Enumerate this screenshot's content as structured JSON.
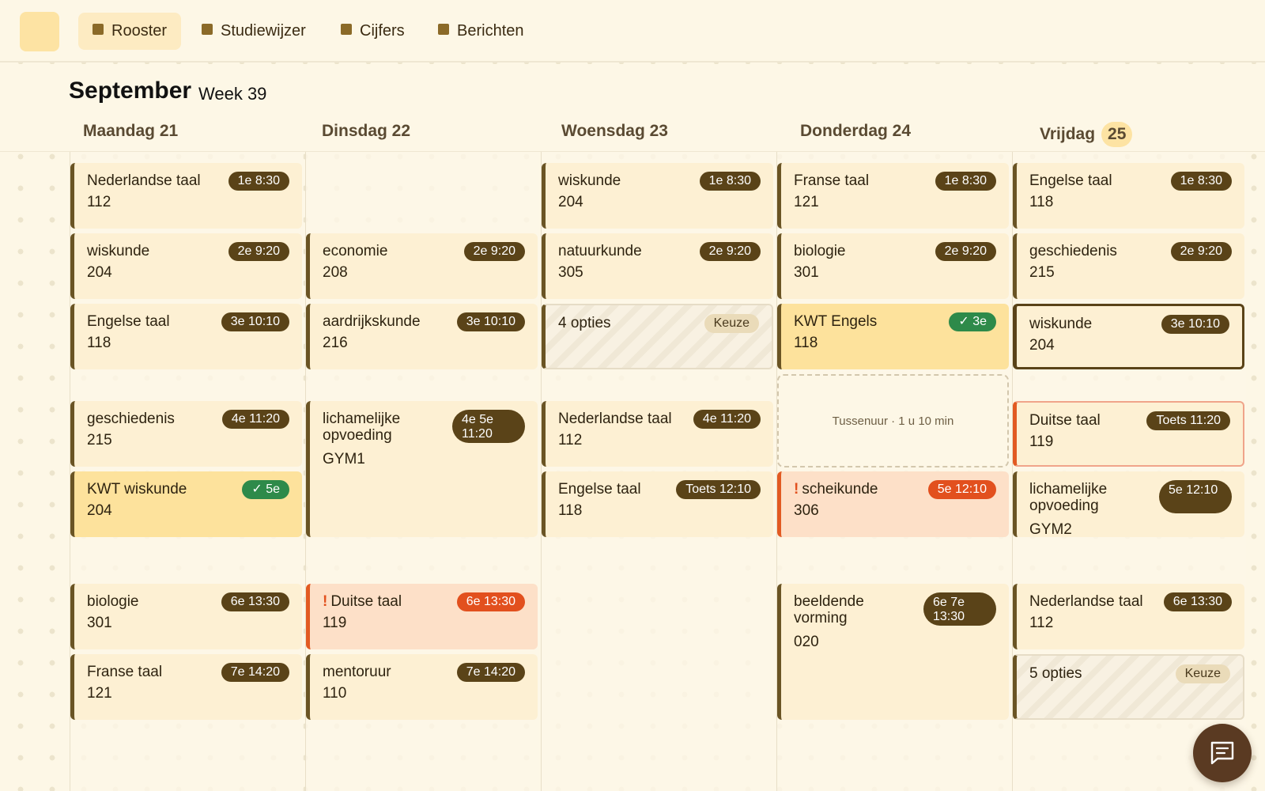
{
  "nav": {
    "tabs": [
      {
        "label": "Rooster",
        "active": true
      },
      {
        "label": "Studiewijzer",
        "active": false
      },
      {
        "label": "Cijfers",
        "active": false
      },
      {
        "label": "Berichten",
        "active": false
      }
    ]
  },
  "header": {
    "month": "September",
    "week": "Week 39"
  },
  "days": [
    {
      "label": "Maandag 21"
    },
    {
      "label": "Dinsdag 22"
    },
    {
      "label": "Woensdag 23"
    },
    {
      "label": "Donderdag 24"
    },
    {
      "label": "Vrijdag",
      "day_number": "25",
      "today": true
    }
  ],
  "lessons": {
    "mon": [
      {
        "subject": "Nederlandse taal",
        "room": "112",
        "badge": "1e 8:30"
      },
      {
        "subject": "wiskunde",
        "room": "204",
        "badge": "2e 9:20"
      },
      {
        "subject": "Engelse taal",
        "room": "118",
        "badge": "3e 10:10"
      },
      {
        "subject": "geschiedenis",
        "room": "215",
        "badge": "4e 11:20"
      },
      {
        "subject": "KWT wiskunde",
        "room": "204",
        "badge": "✓ 5e",
        "status": "kwt-chosen"
      },
      {
        "subject": "biologie",
        "room": "301",
        "badge": "6e 13:30"
      },
      {
        "subject": "Franse taal",
        "room": "121",
        "badge": "7e 14:20"
      }
    ],
    "tue": [
      {
        "subject": "economie",
        "room": "208",
        "badge": "2e 9:20"
      },
      {
        "subject": "aardrijkskunde",
        "room": "216",
        "badge": "3e 10:10"
      },
      {
        "subject": "lichamelijke opvoeding",
        "room": "GYM1",
        "badge": "4e 5e 11:20"
      },
      {
        "subject": "Duitse taal",
        "room": "119",
        "badge": "6e 13:30",
        "status": "warning",
        "mark": "!"
      },
      {
        "subject": "mentoruur",
        "room": "110",
        "badge": "7e 14:20"
      }
    ],
    "wed": [
      {
        "subject": "wiskunde",
        "room": "204",
        "badge": "1e 8:30"
      },
      {
        "subject": "natuurkunde",
        "room": "305",
        "badge": "2e 9:20"
      },
      {
        "subject": "4 opties",
        "badge": "Keuze",
        "status": "choice"
      },
      {
        "subject": "Nederlandse taal",
        "room": "112",
        "badge": "4e 11:20"
      },
      {
        "subject": "Engelse taal",
        "room": "118",
        "badge": "Toets 12:10"
      }
    ],
    "thu": [
      {
        "subject": "Franse taal",
        "room": "121",
        "badge": "1e 8:30"
      },
      {
        "subject": "biologie",
        "room": "301",
        "badge": "2e 9:20"
      },
      {
        "subject": "KWT Engels",
        "room": "118",
        "badge": "✓ 3e",
        "status": "kwt-chosen"
      },
      {
        "gap_label": "Tussenuur · 1 u 10 min"
      },
      {
        "subject": "scheikunde",
        "room": "306",
        "badge": "5e 12:10",
        "status": "warning",
        "mark": "!"
      },
      {
        "subject": "beeldende vorming",
        "room": "020",
        "badge": "6e 7e 13:30"
      }
    ],
    "fri": [
      {
        "subject": "Engelse taal",
        "room": "118",
        "badge": "1e 8:30"
      },
      {
        "subject": "geschiedenis",
        "room": "215",
        "badge": "2e 9:20"
      },
      {
        "subject": "wiskunde",
        "room": "204",
        "badge": "3e 10:10",
        "status": "selected"
      },
      {
        "subject": "Duitse taal",
        "room": "119",
        "badge": "Toets 11:20",
        "status": "test"
      },
      {
        "subject": "lichamelijke opvoeding",
        "room": "GYM2",
        "badge": "5e 12:10"
      },
      {
        "subject": "Nederlandse taal",
        "room": "112",
        "badge": "6e 13:30"
      },
      {
        "subject": "5 opties",
        "badge": "Keuze",
        "status": "choice"
      }
    ]
  },
  "icons": {
    "chat": "chat-icon",
    "nav_bullet": "square-icon"
  },
  "colors": {
    "background": "#fdf7e6",
    "card": "#fdf0d3",
    "card_border": "#6a5424",
    "kwt_card": "#fde29c",
    "kwt_badge": "#2e8a4a",
    "warning_card": "#fde0c8",
    "warning_accent": "#e2501e",
    "badge": "#5a4318",
    "fab": "#5a3a22"
  }
}
